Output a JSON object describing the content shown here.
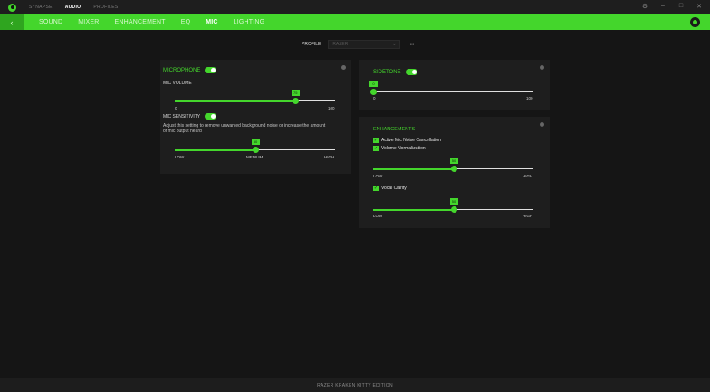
{
  "titlebar": {
    "tabs": [
      {
        "label": "SYNAPSE",
        "active": false
      },
      {
        "label": "AUDIO",
        "active": true
      },
      {
        "label": "PROFILES",
        "active": false
      }
    ],
    "controls": {
      "settings": "⚙",
      "minimize": "–",
      "maximize": "□",
      "close": "✕"
    }
  },
  "nav": {
    "back": "‹",
    "tabs": [
      {
        "label": "SOUND",
        "active": false
      },
      {
        "label": "MIXER",
        "active": false
      },
      {
        "label": "ENHANCEMENT",
        "active": false
      },
      {
        "label": "EQ",
        "active": false
      },
      {
        "label": "MIC",
        "active": true
      },
      {
        "label": "LIGHTING",
        "active": false
      }
    ]
  },
  "profile": {
    "label": "PROFILE",
    "value": "RAZER",
    "chevron": "⌄",
    "more": "···"
  },
  "microphone": {
    "title": "MICROPHONE",
    "enabled": true,
    "volume": {
      "label": "MIC VOLUME",
      "value": "75",
      "level": 75,
      "min": "0",
      "max": "100"
    },
    "sensitivity": {
      "label": "MIC SENSITIVITY",
      "enabled": true,
      "description": "Adjust this setting to remove unwanted background noise or increase the amount of mic output heard",
      "value": "50",
      "level": 50,
      "low": "LOW",
      "mid": "MEDIUM",
      "high": "HIGH"
    }
  },
  "sidetone": {
    "title": "SIDETONE",
    "enabled": true,
    "value": "0",
    "level": 0,
    "min": "0",
    "max": "100"
  },
  "enhancements": {
    "title": "ENHANCEMENTS",
    "noise_cancellation": {
      "label": "Active Mic Noise Cancellation",
      "checked": true
    },
    "normalization": {
      "label": "Volume Normalization",
      "checked": true,
      "value": "50",
      "level": 50,
      "low": "LOW",
      "high": "HIGH"
    },
    "clarity": {
      "label": "Vocal Clarity",
      "checked": true,
      "value": "50",
      "level": 50,
      "low": "LOW",
      "high": "HIGH"
    }
  },
  "footer": {
    "device": "RAZER KRAKEN KITTY EDITION"
  },
  "colors": {
    "accent": "#44d62c",
    "background": "#151515",
    "panel": "#1e1e1e"
  }
}
